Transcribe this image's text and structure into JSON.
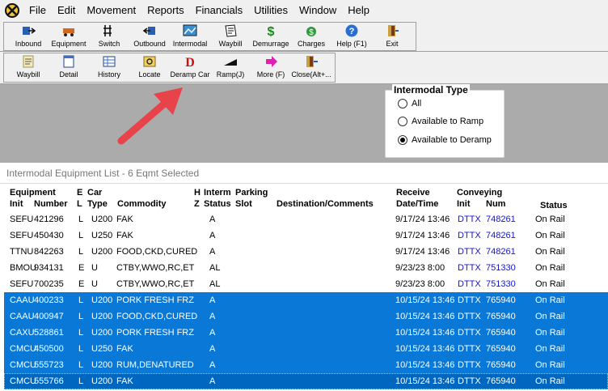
{
  "menu": {
    "items": [
      "File",
      "Edit",
      "Movement",
      "Reports",
      "Financials",
      "Utilities",
      "Window",
      "Help"
    ]
  },
  "toolbar1": {
    "buttons": [
      {
        "label": "Inbound",
        "icon": "inbound-icon"
      },
      {
        "label": "Equipment",
        "icon": "equipment-icon"
      },
      {
        "label": "Switch",
        "icon": "switch-icon"
      },
      {
        "label": "Outbound",
        "icon": "outbound-icon"
      },
      {
        "label": "Intermodal",
        "icon": "intermodal-icon"
      },
      {
        "label": "Waybill",
        "icon": "waybill-icon"
      },
      {
        "label": "Demurrage",
        "icon": "dollar-icon"
      },
      {
        "label": "Charges",
        "icon": "charges-icon"
      },
      {
        "label": "Help (F1)",
        "icon": "help-icon"
      },
      {
        "label": "Exit",
        "icon": "exit-icon"
      }
    ]
  },
  "toolbar2": {
    "buttons": [
      {
        "label": "Waybill",
        "icon": "waybill-doc-icon"
      },
      {
        "label": "Detail",
        "icon": "detail-icon"
      },
      {
        "label": "History",
        "icon": "history-icon"
      },
      {
        "label": "Locate",
        "icon": "locate-icon"
      },
      {
        "label": "Deramp Car",
        "icon": "deramp-icon"
      },
      {
        "label": "Ramp(J)",
        "icon": "ramp-icon"
      },
      {
        "label": "More (F)",
        "icon": "more-arrow-icon"
      },
      {
        "label": "Close(Alt+...",
        "icon": "close-door-icon"
      }
    ]
  },
  "intermodal_type": {
    "title": "Intermodal Type",
    "options": [
      "All",
      "Available to Ramp",
      "Available to Deramp"
    ],
    "selected": "Available to Deramp"
  },
  "list": {
    "title": "Intermodal Equipment List - 6 Eqmt Selected",
    "headers": {
      "equipment": "Equipment",
      "init": "Init",
      "number": "Number",
      "e": "E",
      "l": "L",
      "car": "Car",
      "type": "Type",
      "commodity": "Commodity",
      "h": "H",
      "z": "Z",
      "interm": "Interm",
      "status1": "Status",
      "parking": "Parking",
      "slot": "Slot",
      "destination": "Destination/Comments",
      "receive": "Receive",
      "datetime": "Date/Time",
      "conveying": "Conveying",
      "cinit": "Init",
      "cnum": "Num",
      "status": "Status"
    },
    "rows": [
      {
        "init": "SEFU",
        "number": "421296",
        "el": "L",
        "type": "U200",
        "commodity": "FAK",
        "interm": "A",
        "date": "9/17/24 13:46",
        "cinit": "DTTX",
        "cnum": "748261",
        "status": "On Rail",
        "selected": false
      },
      {
        "init": "SEFU",
        "number": "450430",
        "el": "L",
        "type": "U250",
        "commodity": "FAK",
        "interm": "A",
        "date": "9/17/24 13:46",
        "cinit": "DTTX",
        "cnum": "748261",
        "status": "On Rail",
        "selected": false
      },
      {
        "init": "TTNU",
        "number": "842263",
        "el": "L",
        "type": "U200",
        "commodity": "FOOD,CKD,CURED",
        "interm": "A",
        "date": "9/17/24 13:46",
        "cinit": "DTTX",
        "cnum": "748261",
        "status": "On Rail",
        "selected": false
      },
      {
        "init": "BMOU",
        "number": "934131",
        "el": "E",
        "type": "U",
        "commodity": "CTBY,WWO,RC,ET",
        "interm": "AL",
        "date": "9/23/23 8:00",
        "cinit": "DTTX",
        "cnum": "751330",
        "status": "On Rail",
        "selected": false
      },
      {
        "init": "SEFU",
        "number": "700235",
        "el": "E",
        "type": "U",
        "commodity": "CTBY,WWO,RC,ET",
        "interm": "AL",
        "date": "9/23/23 8:00",
        "cinit": "DTTX",
        "cnum": "751330",
        "status": "On Rail",
        "selected": false
      },
      {
        "init": "CAAU",
        "number": "400233",
        "el": "L",
        "type": "U200",
        "commodity": "PORK FRESH FRZ",
        "interm": "A",
        "date": "10/15/24 13:46",
        "cinit": "DTTX",
        "cnum": "765940",
        "status": "On Rail",
        "selected": true
      },
      {
        "init": "CAAU",
        "number": "400947",
        "el": "L",
        "type": "U200",
        "commodity": "FOOD,CKD,CURED",
        "interm": "A",
        "date": "10/15/24 13:46",
        "cinit": "DTTX",
        "cnum": "765940",
        "status": "On Rail",
        "selected": true
      },
      {
        "init": "CAXU",
        "number": "528861",
        "el": "L",
        "type": "U200",
        "commodity": "PORK FRESH FRZ",
        "interm": "A",
        "date": "10/15/24 13:46",
        "cinit": "DTTX",
        "cnum": "765940",
        "status": "On Rail",
        "selected": true
      },
      {
        "init": "CMCU",
        "number": "450500",
        "el": "L",
        "type": "U250",
        "commodity": "FAK",
        "interm": "A",
        "date": "10/15/24 13:46",
        "cinit": "DTTX",
        "cnum": "765940",
        "status": "On Rail",
        "selected": true
      },
      {
        "init": "CMCU",
        "number": "555723",
        "el": "L",
        "type": "U200",
        "commodity": "RUM,DENATURED",
        "interm": "A",
        "date": "10/15/24 13:46",
        "cinit": "DTTX",
        "cnum": "765940",
        "status": "On Rail",
        "selected": true
      },
      {
        "init": "CMCU",
        "number": "555766",
        "el": "L",
        "type": "U200",
        "commodity": "FAK",
        "interm": "A",
        "date": "10/15/24 13:46",
        "cinit": "DTTX",
        "cnum": "765940",
        "status": "On Rail",
        "selected": true
      }
    ]
  },
  "colors": {
    "selection": "#0a78d7",
    "link": "#1414cc",
    "arrow": "#e8434a"
  }
}
